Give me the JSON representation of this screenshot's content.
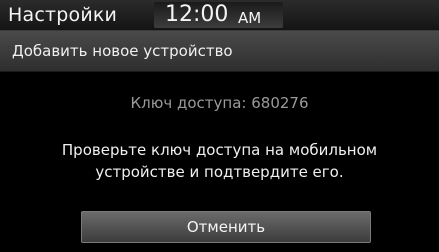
{
  "statusbar": {
    "title": "Настройки",
    "time": "12:00",
    "ampm": "AM"
  },
  "header": {
    "title": "Добавить новое устройство"
  },
  "content": {
    "passkey_label": "Ключ доступа:",
    "passkey_value": "680276",
    "message_line1": "Проверьте ключ доступа на мобильном",
    "message_line2": "устройстве и подтвердите его."
  },
  "actions": {
    "cancel_label": "Отменить"
  }
}
